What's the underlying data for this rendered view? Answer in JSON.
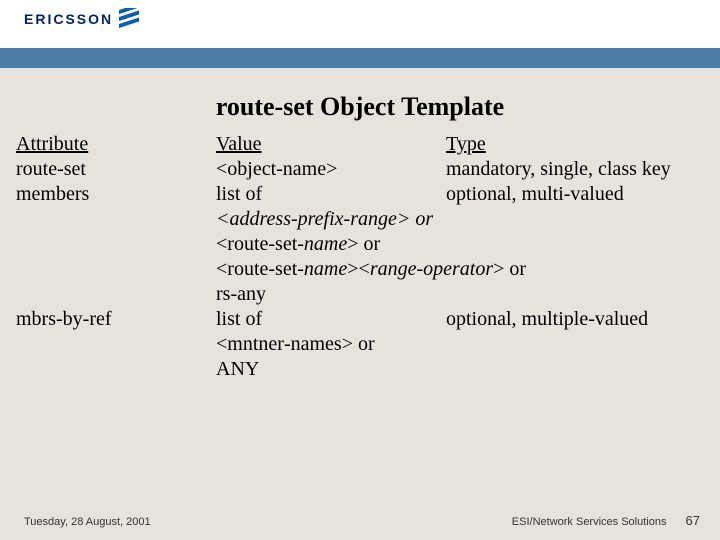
{
  "logo": {
    "text": "ERICSSON"
  },
  "title": "route-set Object Template",
  "headers": {
    "attr": "Attribute",
    "val": "Value",
    "type": "Type"
  },
  "rows": {
    "r1": {
      "attr": "route-set",
      "val": "<object-name>",
      "type": "mandatory, single, class key"
    },
    "r2": {
      "attr": "members",
      "val": "list of",
      "type": "optional, multi-valued"
    },
    "r3": {
      "text": "<address-prefix-range> or"
    },
    "r4a": "<route-set-",
    "r4b": "name",
    "r4c": "> or",
    "r5a": "<route-set-",
    "r5b": "name",
    "r5c": "><",
    "r5d": "range-operator",
    "r5e": "> or",
    "r6": "rs-any",
    "r7": {
      "attr": "mbrs-by-ref",
      "val": "list of",
      "type": "optional, multiple-valued"
    },
    "r8a": "<mntner",
    "r8b": "-",
    "r8c": "names> or",
    "r9": " ANY"
  },
  "footer": {
    "date": "Tuesday, 28 August, 2001",
    "org": "ESI/Network Services Solutions",
    "page": "67"
  }
}
